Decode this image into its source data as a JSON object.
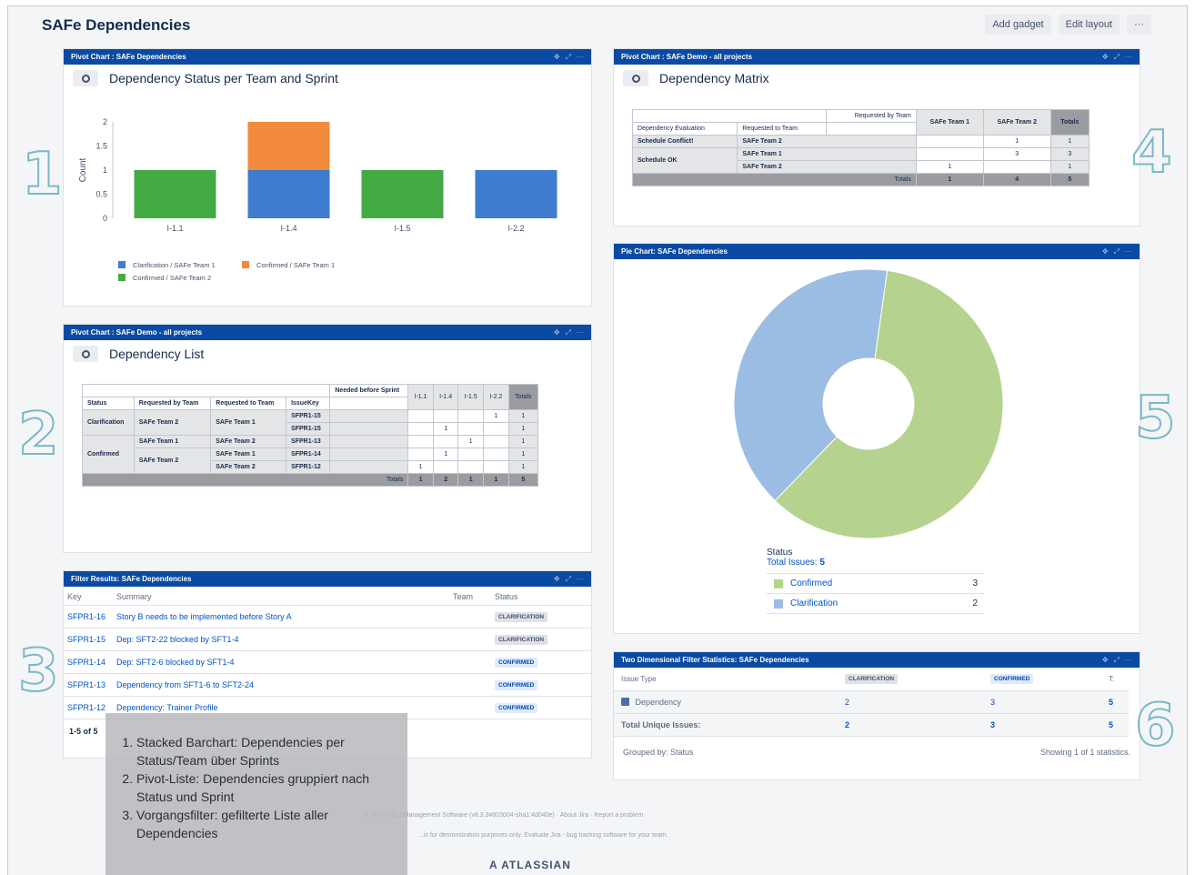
{
  "page": {
    "title": "SAFe Dependencies"
  },
  "toolbar": {
    "add_gadget": "Add gadget",
    "edit_layout": "Edit layout",
    "more": "···"
  },
  "tools": {
    "move": "✥",
    "expand": "⤢",
    "menu": "···"
  },
  "bar_gadget": {
    "header": "Pivot Chart : SAFe Dependencies",
    "title": "Dependency Status per Team and Sprint",
    "legend": [
      "Clarification / SAFe Team 1",
      "Confirmed / SAFe Team 1",
      "Confirmed / SAFe Team 2"
    ]
  },
  "chart_data": {
    "type": "bar",
    "title": "Dependency Status per Team and Sprint",
    "categories": [
      "I-1.1",
      "I-1.4",
      "I-1.5",
      "I-2.2"
    ],
    "ylabel": "Count",
    "ylim": [
      0,
      2
    ],
    "yticks": [
      "0",
      "0.5",
      "1",
      "1.5",
      "2"
    ],
    "stacked": true,
    "series": [
      {
        "name": "Clarification / SAFe Team 1",
        "values": [
          0,
          1,
          0,
          1
        ],
        "color": "#3d7ccf"
      },
      {
        "name": "Confirmed / SAFe Team 1",
        "values": [
          0,
          1,
          0,
          0
        ],
        "color": "#f28a3b"
      },
      {
        "name": "Confirmed / SAFe Team 2",
        "values": [
          1,
          0,
          1,
          0
        ],
        "color": "#44aa44"
      }
    ]
  },
  "matrix_gadget": {
    "header": "Pivot Chart : SAFe Demo - all projects",
    "title": "Dependency Matrix",
    "requested_by": "Requested by Team",
    "col_eval": "Dependency Evaluation",
    "col_req_to": "Requested to Team",
    "col_t1": "SAFe Team 1",
    "col_t2": "SAFe Team 2",
    "col_totals": "Totals",
    "rows": [
      {
        "eval": "Schedule Conflict!",
        "team": "SAFe Team 2",
        "t1": "",
        "t2": "1",
        "tot": "1"
      },
      {
        "eval": "Schedule OK",
        "team": "SAFe Team 1",
        "t1": "",
        "t2": "3",
        "tot": "3"
      },
      {
        "eval": "",
        "team": "SAFe Team 2",
        "t1": "1",
        "t2": "",
        "tot": "1"
      }
    ],
    "totals_label": "Totals",
    "totals": {
      "t1": "1",
      "t2": "4",
      "tot": "5"
    }
  },
  "list_gadget": {
    "header": "Pivot Chart : SAFe Demo - all projects",
    "title": "Dependency List",
    "needed": "Needed before Sprint",
    "h_status": "Status",
    "h_req_by": "Requested by Team",
    "h_req_to": "Requested to Team",
    "h_key": "IssueKey",
    "sprints": [
      "I-1.1",
      "I-1.4",
      "I-1.5",
      "I-2.2"
    ],
    "h_totals": "Totals",
    "status_clar": "Clarification",
    "status_conf": "Confirmed",
    "rows": [
      {
        "by": "SAFe Team 2",
        "to": "SAFe Team 1",
        "key": "SFPR1-15",
        "v": [
          "",
          "",
          "",
          "1"
        ],
        "tot": "1"
      },
      {
        "key": "SFPR1-15",
        "v": [
          "",
          "1",
          "",
          ""
        ],
        "tot": "1"
      },
      {
        "by": "SAFe Team 1",
        "to": "SAFe Team 2",
        "key": "SFPR1-13",
        "v": [
          "",
          "",
          "1",
          ""
        ],
        "tot": "1"
      },
      {
        "by": "SAFe Team 2",
        "to": "SAFe Team 1",
        "key": "SFPR1-14",
        "v": [
          "",
          "1",
          "",
          ""
        ],
        "tot": "1"
      },
      {
        "to": "SAFe Team 2",
        "key": "SFPR1-12",
        "v": [
          "1",
          "",
          "",
          ""
        ],
        "tot": "1"
      }
    ],
    "totals_label": "Totals",
    "totals": [
      "1",
      "2",
      "1",
      "1",
      "5"
    ]
  },
  "filter_gadget": {
    "header": "Filter Results: SAFe Dependencies",
    "col_key": "Key",
    "col_summary": "Summary",
    "col_team": "Team",
    "col_status": "Status",
    "rows": [
      {
        "key": "SFPR1-16",
        "summary": "Story B needs to be implemented before Story A",
        "status": "CLARIFICATION"
      },
      {
        "key": "SFPR1-15",
        "summary": "Dep: SFT2-22 blocked by SFT1-4",
        "status": "CLARIFICATION"
      },
      {
        "key": "SFPR1-14",
        "summary": "Dep: SFT2-6 blocked by SFT1-4",
        "status": "CONFIRMED"
      },
      {
        "key": "SFPR1-13",
        "summary": "Dependency from SFT1-6 to SFT2-24",
        "status": "CONFIRMED"
      },
      {
        "key": "SFPR1-12",
        "summary": "Dependency: Trainer Profile",
        "status": "CONFIRMED"
      }
    ],
    "pager": "1-5 of 5"
  },
  "pie_gadget": {
    "header": "Pie Chart: SAFe Dependencies",
    "legend_title": "Status",
    "total_label": "Total Issues:",
    "total_value": "5",
    "slices": [
      {
        "label": "Confirmed",
        "value": 3,
        "color": "#b5d38f"
      },
      {
        "label": "Clarification",
        "value": 2,
        "color": "#9cbde3"
      }
    ]
  },
  "stats_gadget": {
    "header": "Two Dimensional Filter Statistics: SAFe Dependencies",
    "col_type": "Issue Type",
    "col_clar": "CLARIFICATION",
    "col_conf": "CONFIRMED",
    "col_t": "T:",
    "row_label": "Dependency",
    "row_values": [
      "2",
      "3",
      "5"
    ],
    "total_label": "Total Unique Issues:",
    "total_values": [
      "2",
      "3",
      "5"
    ],
    "grouped_by": "Grouped by: Status",
    "showing": "Showing 1 of 1 statistics."
  },
  "annotations": [
    "1",
    "2",
    "3",
    "4",
    "5",
    "6"
  ],
  "overlay": {
    "items": [
      "Stacked Barchart: Dependencies per Status/Team über Sprints",
      "Pivot-Liste: Dependencies gruppiert nach Status und Sprint",
      "Vorgangsfilter: gefilterte Liste aller Dependencies"
    ]
  },
  "footer": {
    "line1": "...n Jira Project Management Software (v8.3.3#803004-sha1:4d040e) · About Jira · Report a problem",
    "line2": "...is for demonstration purposes only. Evaluate Jira - bug tracking software for your team.",
    "brand": "A ATLASSIAN"
  }
}
